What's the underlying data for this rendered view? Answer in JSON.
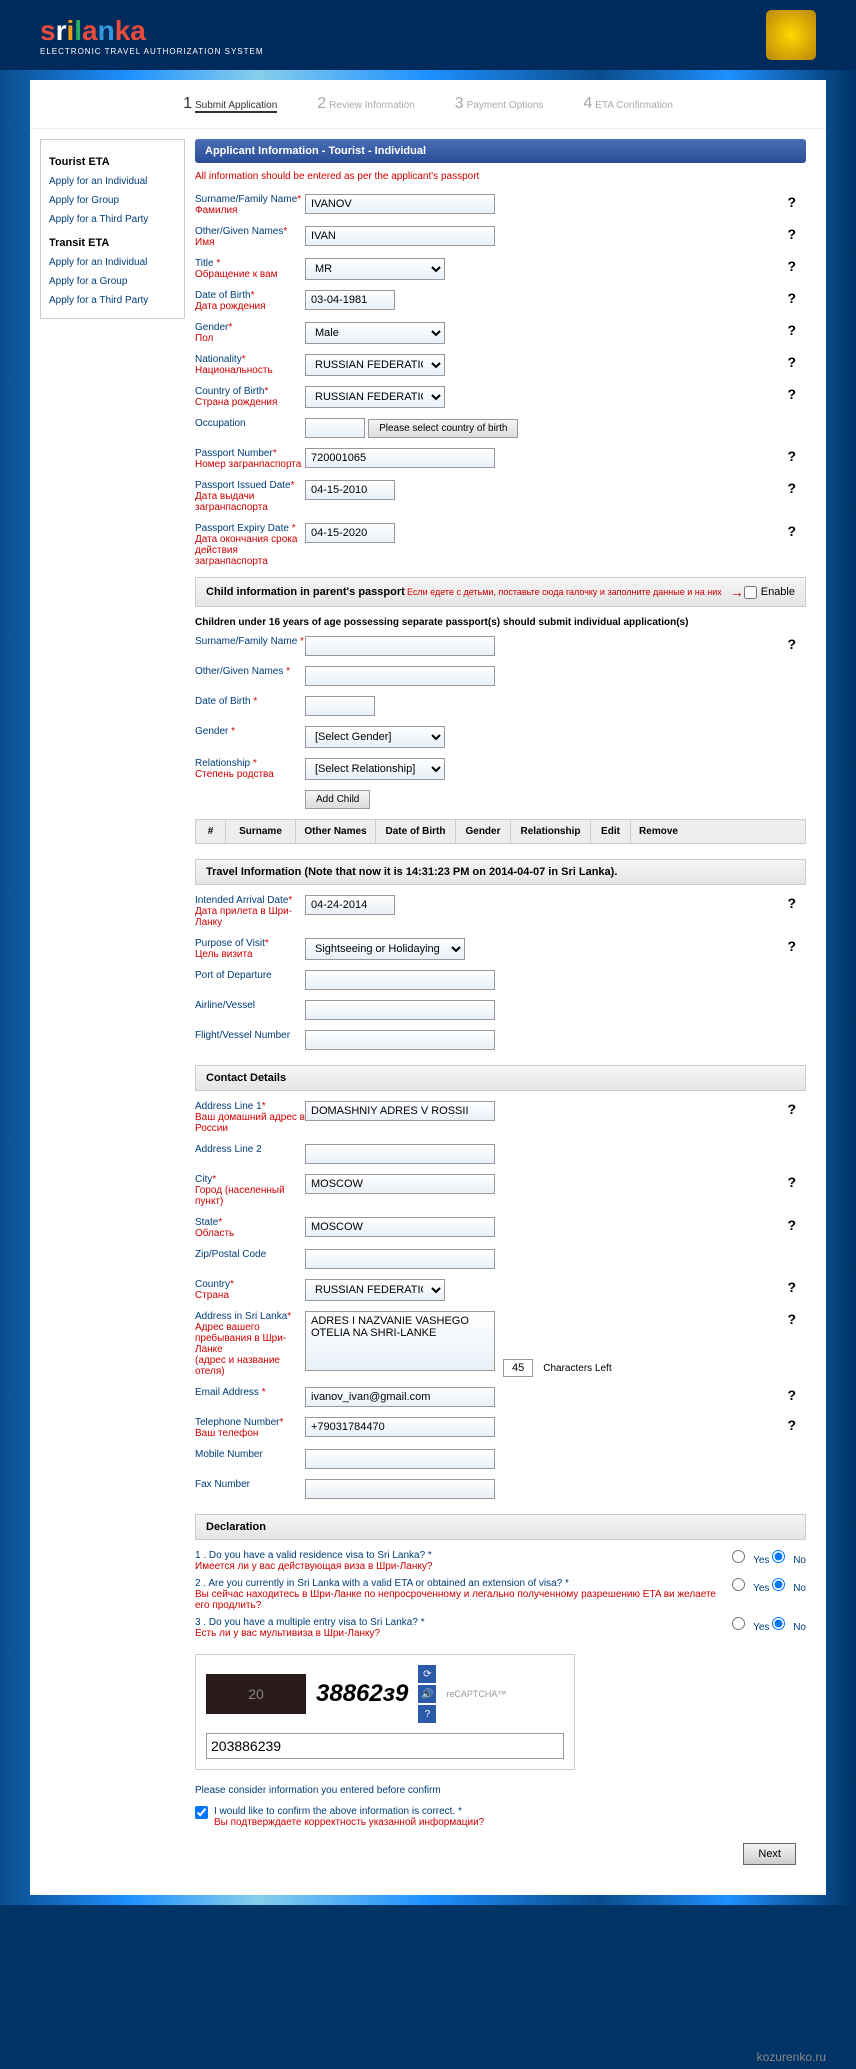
{
  "logo_sub": "ELECTRONIC TRAVEL AUTHORIZATION SYSTEM",
  "steps": [
    {
      "num": "1",
      "label": "Submit\nApplication"
    },
    {
      "num": "2",
      "label": "Review\nInformation"
    },
    {
      "num": "3",
      "label": "Payment\nOptions"
    },
    {
      "num": "4",
      "label": "ETA\nConfirmation"
    }
  ],
  "sidebar": {
    "h1": "Tourist ETA",
    "links1": [
      "Apply for an Individual",
      "Apply for Group",
      "Apply for a Third Party"
    ],
    "h2": "Transit ETA",
    "links2": [
      "Apply for an Individual",
      "Apply for a Group",
      "Apply for a Third Party"
    ]
  },
  "section_title": "Applicant Information - Tourist - Individual",
  "notice": "All information should be entered as per the applicant's passport",
  "fields": {
    "surname": {
      "label": "Surname/Family Name",
      "ru": "Фамилия",
      "value": "IVANOV"
    },
    "given": {
      "label": "Other/Given Names",
      "ru": "Имя",
      "value": "IVAN"
    },
    "title": {
      "label": "Title",
      "ru": "Обращение к вам",
      "value": "MR"
    },
    "dob": {
      "label": "Date of Birth",
      "ru": "Дата рождения",
      "value": "03-04-1981"
    },
    "gender": {
      "label": "Gender",
      "ru": "Пол",
      "value": "Male"
    },
    "nationality": {
      "label": "Nationality",
      "ru": "Национальность",
      "value": "RUSSIAN FEDERATION (F"
    },
    "cob": {
      "label": "Country of Birth",
      "ru": "Страна рождения",
      "value": "RUSSIAN FEDERATION (F"
    },
    "occupation": {
      "label": "Occupation",
      "btn": "Please select country of birth"
    },
    "passport": {
      "label": "Passport Number",
      "ru": "Номер загранпаспорта",
      "value": "720001065"
    },
    "issued": {
      "label": "Passport Issued Date",
      "ru": "Дата выдачи загранпаспорта",
      "value": "04-15-2010"
    },
    "expiry": {
      "label": "Passport Expiry Date",
      "ru": "Дата окончания срока действия загранпаспорта",
      "value": "04-15-2020"
    }
  },
  "child_section": {
    "title": "Child information in parent's passport",
    "note": "Если едете с детьми, поставьте сюда галочку и заполните данные и на них",
    "enable": "Enable",
    "sub": "Children under 16 years of age possessing separate passport(s) should submit individual application(s)",
    "fields": {
      "surname": "Surname/Family Name",
      "given": "Other/Given Names",
      "dob": "Date of Birth",
      "gender": "Gender",
      "gender_val": "[Select Gender]",
      "rel": "Relationship",
      "rel_ru": "Степень родства",
      "rel_val": "[Select Relationship]",
      "add_btn": "Add Child"
    },
    "table": [
      "#",
      "Surname",
      "Other Names",
      "Date of Birth",
      "Gender",
      "Relationship",
      "Edit",
      "Remove"
    ]
  },
  "travel": {
    "header": "Travel Information    (Note that now it is 14:31:23 PM on 2014-04-07 in Sri Lanka).",
    "arrival": {
      "label": "Intended Arrival Date",
      "ru": "Дата прилета в Шри-Ланку",
      "value": "04-24-2014"
    },
    "purpose": {
      "label": "Purpose of Visit",
      "ru": "Цель визита",
      "value": "Sightseeing or Holidaying"
    },
    "port": "Port of Departure",
    "airline": "Airline/Vessel",
    "flight": "Flight/Vessel Number"
  },
  "contact": {
    "header": "Contact Details",
    "addr1": {
      "label": "Address Line 1",
      "ru": "Ваш домашний адрес в России",
      "value": "DOMASHNIY ADRES V ROSSII"
    },
    "addr2": "Address Line 2",
    "city": {
      "label": "City",
      "ru": "Город (населенный пункт)",
      "value": "MOSCOW"
    },
    "state": {
      "label": "State",
      "ru": "Область",
      "value": "MOSCOW"
    },
    "zip": "Zip/Postal Code",
    "country": {
      "label": "Country",
      "ru": "Страна",
      "value": "RUSSIAN FEDERATION (F"
    },
    "sladdr": {
      "label": "Address in Sri Lanka",
      "ru": "Адрес вашего\nпребывания в Шри-Ланке\n(адрес и название отеля)",
      "value": "ADRES I NAZVANIE VASHEGO OTELIA NA SHRI-LANKE",
      "chars": "45",
      "chars_label": "Characters Left"
    },
    "email": {
      "label": "Email Address",
      "value": "ivanov_ivan@gmail.com"
    },
    "phone": {
      "label": "Telephone Number",
      "ru": "Ваш телефон",
      "value": "+79031784470"
    },
    "mobile": "Mobile Number",
    "fax": "Fax Number"
  },
  "decl": {
    "header": "Declaration",
    "q1": "1 . Do you have a valid residence visa to Sri Lanka?",
    "q1_ru": "Имеется ли у вас действующая виза в Шри-Ланку?",
    "q2": "2 . Are you currently in Sri Lanka with a valid ETA or obtained an extension of visa?",
    "q2_ru": "Вы сейчас находитесь в Шри-Ланке по непросроченному и легально полученному разрешению ETA ви желаете его продлить?",
    "q3": "3 . Do you have a multiple entry visa to Sri Lanka?",
    "q3_ru": "Есть ли у вас мультивиза в Шри-Ланку?",
    "yes": "Yes",
    "no": "No"
  },
  "captcha": {
    "img": "20",
    "text": "38862з9",
    "brand": "reCAPTCHA™",
    "input": "203886239"
  },
  "confirm_note": "Please consider information you entered before confirm",
  "confirm_check": "I would like to confirm the above information is correct.",
  "confirm_ru": "Вы подтверждаете корректность указанной информации?",
  "next": "Next",
  "watermark": "kozurenko.ru"
}
